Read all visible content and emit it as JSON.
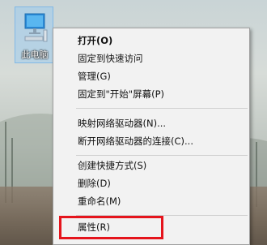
{
  "desktop": {
    "icon_label": "此电脑",
    "icon_name": "computer-icon"
  },
  "context_menu": {
    "items": [
      {
        "label": "打开(O)"
      },
      {
        "label": "固定到快速访问"
      },
      {
        "label": "管理(G)"
      },
      {
        "label": "固定到\"开始\"屏幕(P)"
      },
      {
        "label": "映射网络驱动器(N)..."
      },
      {
        "label": "断开网络驱动器的连接(C)..."
      },
      {
        "label": "创建快捷方式(S)"
      },
      {
        "label": "删除(D)"
      },
      {
        "label": "重命名(M)"
      },
      {
        "label": "属性(R)"
      }
    ],
    "highlight_color": "#e5141c"
  }
}
